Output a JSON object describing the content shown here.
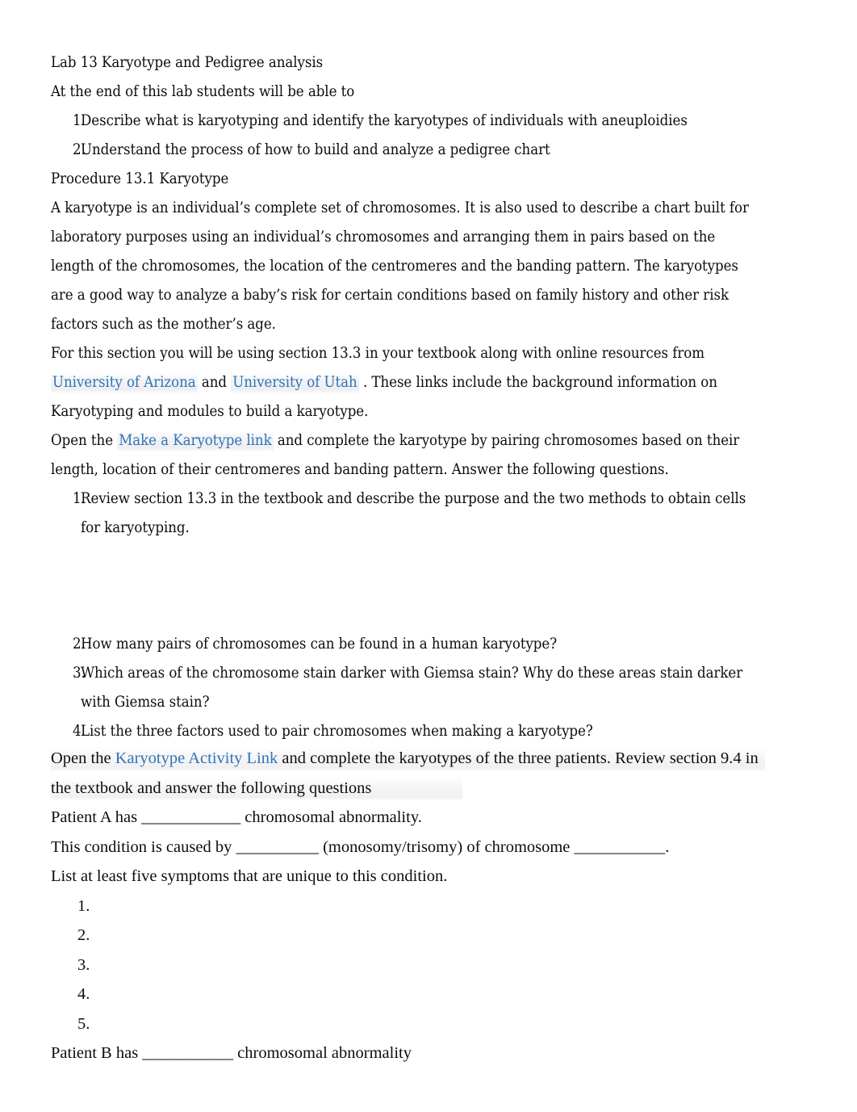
{
  "document": {
    "title": "Lab 13 Karyotype and Pedigree analysis",
    "intro_line": "At the end of this lab students will be able to",
    "objectives": [
      {
        "num": "1.",
        "text": "Describe what is karyotyping and identify the karyotypes of individuals with aneuploidies"
      },
      {
        "num": "2.",
        "text": "Understand the process of how to build and analyze a pedigree chart"
      }
    ],
    "procedure_heading": "Procedure 13.1 Karyotype",
    "karyotype_definition": "A karyotype is an individual’s complete set of chromosomes. It is also used to describe a chart built for laboratory purposes using an individual’s chromosomes and arranging them in pairs based on the length of the chromosomes, the location of the centromeres and the banding pattern. The karyotypes are a good way to analyze a baby’s risk for certain conditions based on family history and other risk factors such as the mother’s age.",
    "resources_paragraph": {
      "before_first_link": "For this section you will be using section 13.3 in your textbook along with online resources from ",
      "link_arizona": "University of Arizona",
      "between_links": "  and  ",
      "link_utah": "University of Utah",
      "after_links": " . These links include the background information on Karyotyping and modules to build a karyotype."
    },
    "make_karyotype_paragraph": {
      "before_link": "Open the  ",
      "link_label": "Make a Karyotype link",
      "after_link": "  and complete the karyotype by pairing chromosomes based on their length, location of their centromeres and banding pattern. Answer the following questions."
    },
    "questions": [
      {
        "num": "1.",
        "text": "Review section 13.3 in the textbook and describe the purpose and the two methods to obtain cells for karyotyping."
      },
      {
        "num": "2.",
        "text": "How many pairs of chromosomes can be found in a human karyotype?"
      },
      {
        "num": "3.",
        "text": "Which areas of the chromosome stain darker with Giemsa stain? Why do these areas stain darker with Giemsa stain?"
      },
      {
        "num": "4.",
        "text": "List the three factors used to pair chromosomes when making a karyotype?"
      }
    ],
    "activity_paragraph": {
      "before_link": "Open the  ",
      "link_label": "Karyotype Activity Link",
      "after_link": " and complete the karyotypes of the three patients. Review section 9.4 in the textbook and answer the following questions"
    },
    "patient_a": {
      "line_1": "Patient A has ____________ chromosomal abnormality.",
      "line_2": "This condition is caused by __________ (monosomy/trisomy) of chromosome ___________.",
      "line_3": "List at least five symptoms that are unique to this condition."
    },
    "symptom_list": [
      {
        "num": "1.",
        "text": ""
      },
      {
        "num": "2.",
        "text": ""
      },
      {
        "num": "3.",
        "text": ""
      },
      {
        "num": "4.",
        "text": ""
      },
      {
        "num": "5.",
        "text": ""
      }
    ],
    "patient_b": {
      "line_1": "Patient B has ___________ chromosomal abnormality"
    }
  },
  "colors": {
    "link": "#2E74B5",
    "text": "#0d0d0d",
    "page_background": "#ffffff",
    "highlight": "#efeff2"
  }
}
